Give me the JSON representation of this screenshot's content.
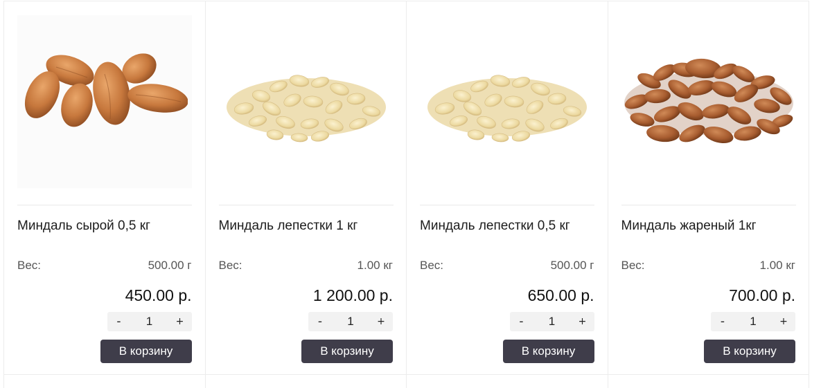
{
  "products": [
    {
      "name": "Миндаль сырой 0,5 кг",
      "weight_label": "Вес:",
      "weight_value": "500.00 г",
      "price": "450.00 р.",
      "quantity": "1",
      "minus_label": "-",
      "plus_label": "+",
      "cart_label": "В корзину",
      "image": "raw-almonds-image"
    },
    {
      "name": "Миндаль лепестки 1 кг",
      "weight_label": "Вес:",
      "weight_value": "1.00 кг",
      "price": "1 200.00 р.",
      "quantity": "1",
      "minus_label": "-",
      "plus_label": "+",
      "cart_label": "В корзину",
      "image": "almond-flakes-image"
    },
    {
      "name": "Миндаль лепестки 0,5 кг",
      "weight_label": "Вес:",
      "weight_value": "500.00 г",
      "price": "650.00 р.",
      "quantity": "1",
      "minus_label": "-",
      "plus_label": "+",
      "cart_label": "В корзину",
      "image": "almond-flakes-image"
    },
    {
      "name": "Миндаль жареный 1кг",
      "weight_label": "Вес:",
      "weight_value": "1.00 кг",
      "price": "700.00 р.",
      "quantity": "1",
      "minus_label": "-",
      "plus_label": "+",
      "cart_label": "В корзину",
      "image": "roasted-almonds-image"
    }
  ],
  "colors": {
    "button_bg": "#3f3d4a",
    "button_text": "#ffffff",
    "qty_bg": "#f2f2f2",
    "border": "#ececec"
  }
}
